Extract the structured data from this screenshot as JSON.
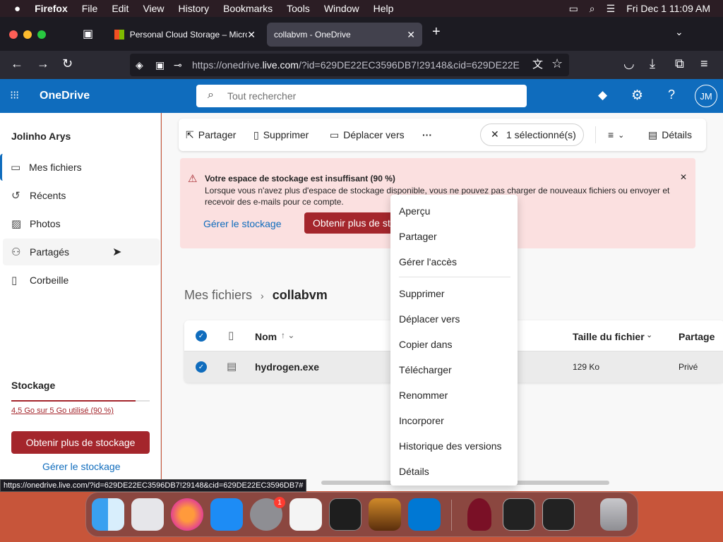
{
  "menubar": {
    "items": [
      "Firefox",
      "File",
      "Edit",
      "View",
      "History",
      "Bookmarks",
      "Tools",
      "Window",
      "Help"
    ],
    "datetime": "Fri Dec 1  11:09 AM"
  },
  "browser": {
    "tabs": [
      {
        "label": "Personal Cloud Storage – Micro"
      },
      {
        "label": "collabvm - OneDrive"
      }
    ],
    "url_prefix": "https://onedrive.",
    "url_host": "live.com",
    "url_rest": "/?id=629DE22EC3596DB7!29148&cid=629DE22E"
  },
  "onedrive": {
    "brand": "OneDrive",
    "search_placeholder": "Tout rechercher",
    "avatar_initials": "JM"
  },
  "sidebar": {
    "user_name": "Jolinho Arys",
    "items": [
      {
        "label": "Mes fichiers"
      },
      {
        "label": "Récents"
      },
      {
        "label": "Photos"
      },
      {
        "label": "Partagés"
      },
      {
        "label": "Corbeille"
      }
    ],
    "storage_heading": "Stockage",
    "storage_usage": "4,5 Go sur 5 Go utilisé (90 %)",
    "storage_fraction": 0.9,
    "get_more_button": "Obtenir plus de stockage",
    "manage_link": "Gérer le stockage"
  },
  "commandbar": {
    "share": "Partager",
    "delete": "Supprimer",
    "move": "Déplacer vers",
    "more": "···",
    "selection": "1 sélectionné(s)",
    "details": "Détails"
  },
  "banner": {
    "title": "Votre espace de stockage est insuffisant (90 %)",
    "body": "Lorsque vous n'avez plus d'espace de stockage disponible, vous ne pouvez pas charger de nouveaux fichiers ou envoyer et recevoir des e-mails pour ce compte.",
    "manage_link": "Gérer le stockage",
    "get_more_button": "Obtenir plus de stockage"
  },
  "breadcrumb": {
    "root": "Mes fichiers",
    "current": "collabvm"
  },
  "filelist": {
    "columns": {
      "name": "Nom",
      "size": "Taille du fichier",
      "sharing": "Partage"
    },
    "rows": [
      {
        "name": "hydrogen.exe",
        "size": "129 Ko",
        "sharing": "Privé"
      }
    ]
  },
  "context_menu": {
    "items": [
      "Aperçu",
      "Partager",
      "Gérer l'accès",
      "Supprimer",
      "Déplacer vers",
      "Copier dans",
      "Télécharger",
      "Renommer",
      "Incorporer",
      "Historique des versions",
      "Détails"
    ]
  },
  "status_url": "https://onedrive.live.com/?id=629DE22EC3596DB7!29148&cid=629DE22EC3596DB7#",
  "dock": {
    "settings_badge": "1"
  }
}
